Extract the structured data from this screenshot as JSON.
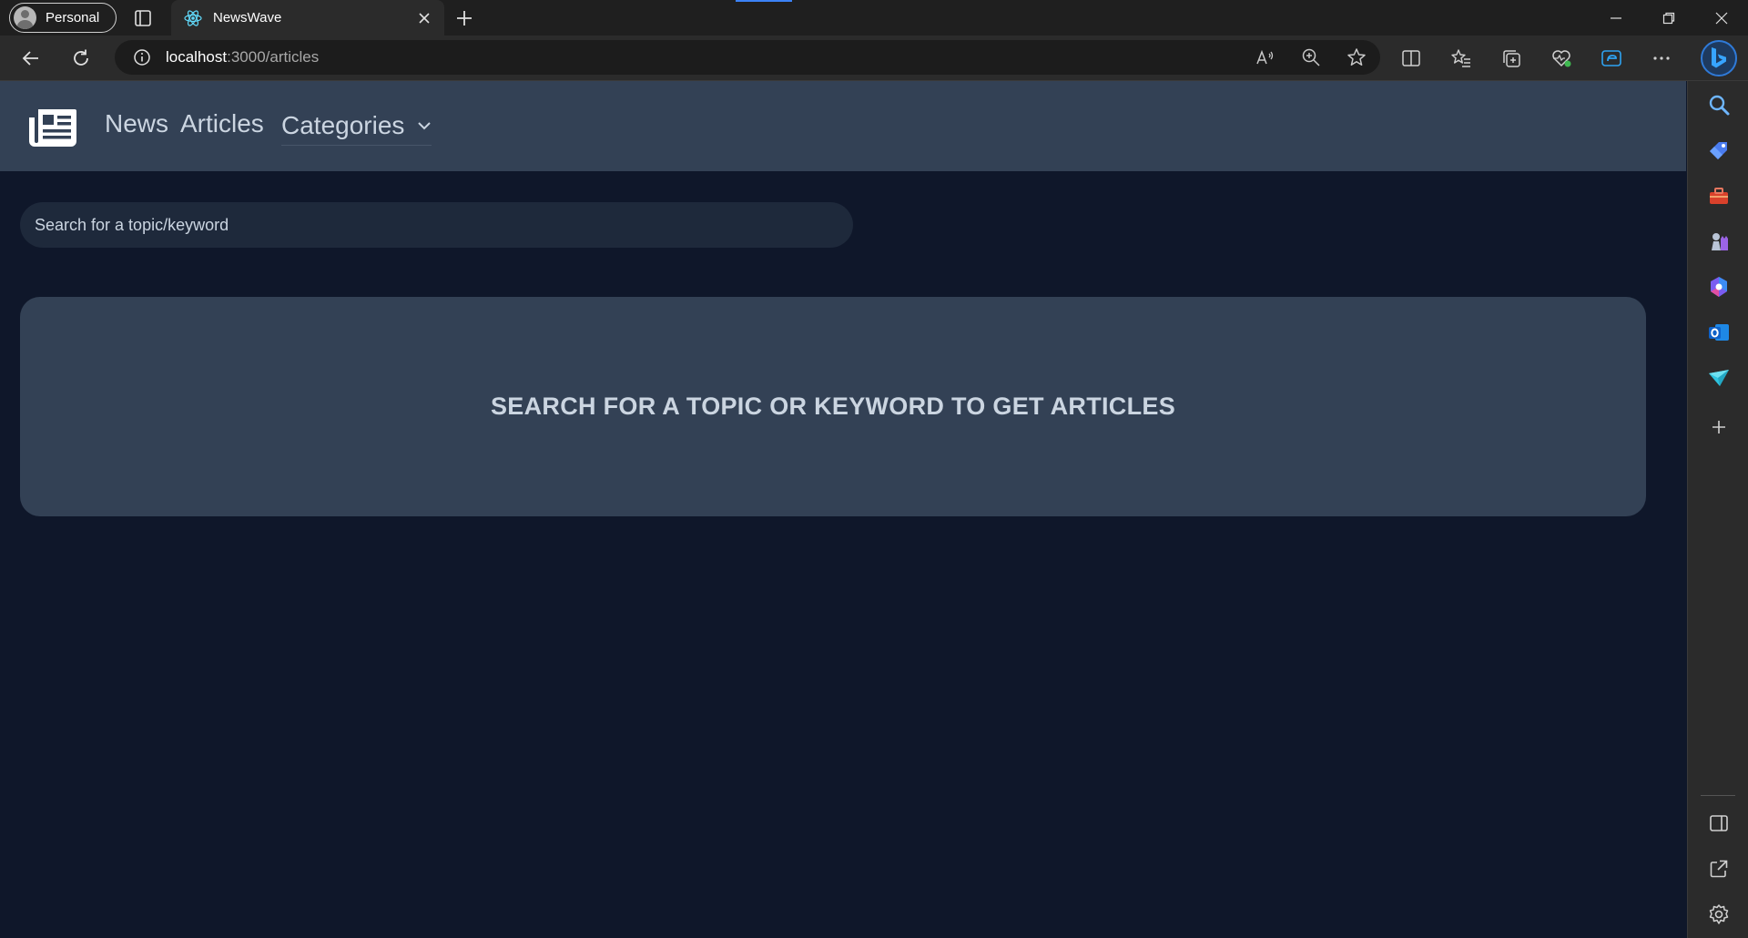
{
  "browser": {
    "profile_label": "Personal",
    "tab_title": "NewsWave",
    "url_host": "localhost",
    "url_path": ":3000/articles"
  },
  "app": {
    "nav": {
      "news": "News",
      "articles": "Articles",
      "categories": "Categories"
    },
    "search": {
      "placeholder": "Search for a topic/keyword",
      "value": ""
    },
    "empty_message": "SEARCH FOR A TOPIC OR KEYWORD TO GET ARTICLES"
  },
  "colors": {
    "page_bg": "#0f172a",
    "navbar_bg": "#334155",
    "search_bg": "#1e293b",
    "card_bg": "#334155",
    "text": "#cbd5e1"
  },
  "icons": {
    "logo": "newspaper-icon",
    "tab_favicon": "react-icon",
    "sidebar": [
      "search-icon",
      "tag-icon",
      "toolbox-icon",
      "chess-icon",
      "copilot-icon",
      "outlook-icon",
      "send-icon",
      "add-icon",
      "sidebar-toggle-icon",
      "external-link-icon",
      "settings-icon"
    ]
  }
}
